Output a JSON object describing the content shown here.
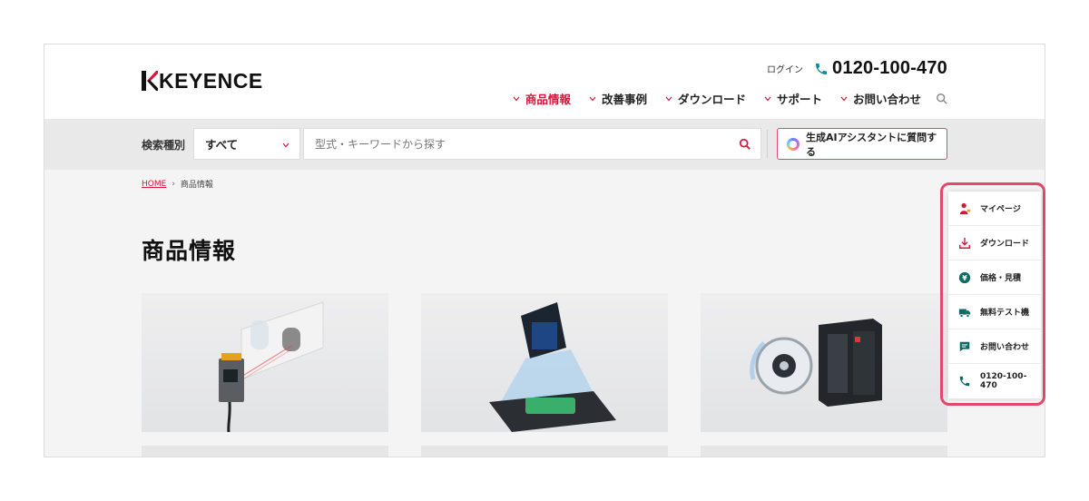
{
  "header": {
    "logo_text": "KEYENCE",
    "login": "ログイン",
    "phone": "0120-100-470",
    "nav": [
      {
        "label": "商品情報",
        "active": true
      },
      {
        "label": "改善事例",
        "active": false
      },
      {
        "label": "ダウンロード",
        "active": false
      },
      {
        "label": "サポート",
        "active": false
      },
      {
        "label": "お問い合わせ",
        "active": false
      }
    ]
  },
  "search": {
    "type_label": "検索種別",
    "type_value": "すべて",
    "placeholder": "型式・キーワードから探す",
    "ai_button": "生成AIアシスタントに質問する"
  },
  "breadcrumb": {
    "home": "HOME",
    "current": "商品情報"
  },
  "page_title": "商品情報",
  "side_panel": {
    "items": [
      {
        "label": "マイページ",
        "icon": "user-icon"
      },
      {
        "label": "ダウンロード",
        "icon": "download-icon"
      },
      {
        "label": "価格・見積",
        "icon": "yen-icon"
      },
      {
        "label": "無料テスト機",
        "icon": "truck-icon"
      },
      {
        "label": "お問い合わせ",
        "icon": "chat-icon"
      },
      {
        "label": "0120-100-470",
        "icon": "phone-icon"
      }
    ]
  },
  "colors": {
    "accent": "#d6163b",
    "outline": "#e2486d"
  }
}
